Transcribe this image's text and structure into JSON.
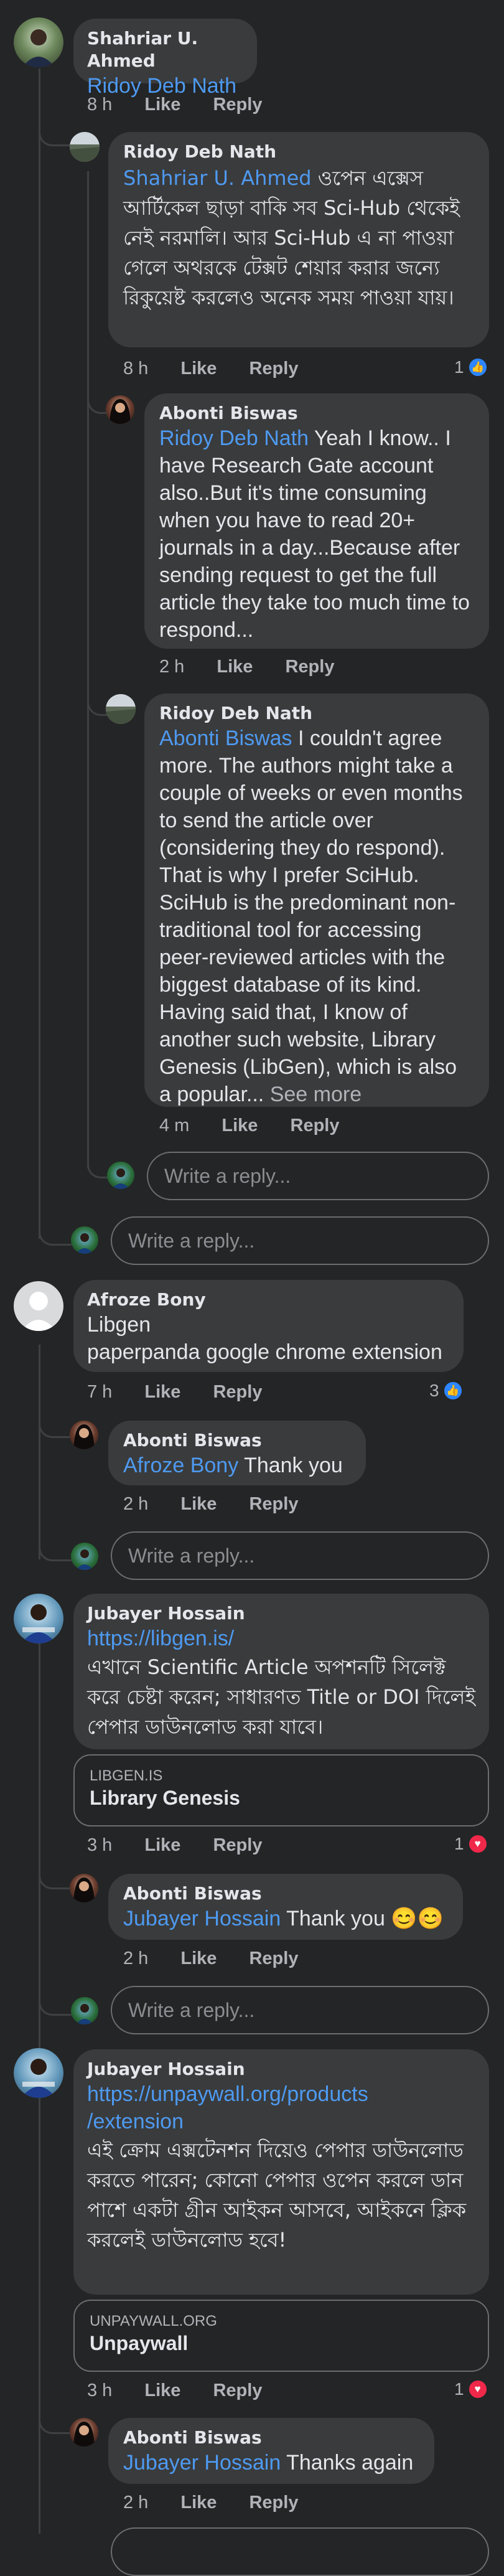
{
  "common": {
    "like_label": "Like",
    "reply_label": "Reply",
    "write_reply_placeholder": "Write a reply..."
  },
  "c1": {
    "author": "Shahriar U. Ahmed",
    "mention": "Ridoy Deb Nath",
    "time": "8 h"
  },
  "c1r1": {
    "author": "Ridoy Deb Nath",
    "mention": "Shahriar U. Ahmed",
    "text": "ওপেন এক্সেস আর্টিকেল ছাড়া বাকি সব Sci-Hub থেকেই নেই নরমালি। আর Sci-Hub এ না পাওয়া গেলে অথরকে টেক্সট শেয়ার করার জন্যে রিকুয়েষ্ট করলেও অনেক সময় পাওয়া যায়।",
    "time": "8 h",
    "reaction_count": "1"
  },
  "c1r2": {
    "author": "Abonti Biswas",
    "mention": "Ridoy Deb Nath",
    "text": "Yeah I know.. I have Research Gate account also..But it's time consuming when you have to read 20+ journals in a day...Because after sending request to get the full article they take too much time to respond...",
    "time": "2 h"
  },
  "c1r3": {
    "author": "Ridoy Deb Nath",
    "mention": "Abonti Biswas",
    "text": "I couldn't agree more. The authors might take a couple of weeks or even months to send the article over (considering they do respond). That is why I prefer SciHub. SciHub is the predominant non-traditional tool for accessing peer-reviewed articles with the biggest database of its kind. Having said that, I know of another such website, Library Genesis (LibGen), which is also a popular...",
    "see_more": "See more",
    "time": "4 m"
  },
  "c2": {
    "author": "Afroze Bony",
    "line1": "Libgen",
    "line2": "paperpanda google chrome extension",
    "time": "7 h",
    "reaction_count": "3"
  },
  "c2r1": {
    "author": "Abonti Biswas",
    "mention": "Afroze Bony",
    "text": "Thank you",
    "time": "2 h"
  },
  "c3": {
    "author": "Jubayer Hossain",
    "link": "https://libgen.is/",
    "text": "এখানে  Scientific Article অপশনটি সিলেক্ট করে চেষ্টা করেন; সাধারণত Title or DOI দিলেই পেপার ডাউনলোড করা যাবে।",
    "preview_domain": "LIBGEN.IS",
    "preview_title": "Library Genesis",
    "time": "3 h",
    "reaction_count": "1"
  },
  "c3r1": {
    "author": "Abonti Biswas",
    "mention": "Jubayer Hossain",
    "text": "Thank you 😊😊",
    "time": "2 h"
  },
  "c4": {
    "author": "Jubayer Hossain",
    "link_line1": "https://unpaywall.org/products",
    "link_line2": "/extension",
    "text": "এই ক্রোম এক্সটেনশন দিয়েও পেপার ডাউনলোড করতে পারেন; কোনো পেপার ওপেন করলে ডান পাশে একটা গ্রীন আইকন আসবে, আইকনে ক্লিক করলেই ডাউনলোড হবে!",
    "preview_domain": "UNPAYWALL.ORG",
    "preview_title": "Unpaywall",
    "time": "3 h",
    "reaction_count": "1"
  },
  "c4r1": {
    "author": "Abonti Biswas",
    "mention": "Jubayer Hossain",
    "text": "Thanks again",
    "time": "2 h"
  },
  "icons": {
    "like_reaction": "thumbs-up-icon",
    "love_reaction": "heart-icon"
  },
  "colors": {
    "background": "#242526",
    "bubble": "#3a3b3c",
    "mention": "#4e9af1",
    "like_blue": "#2d86ff",
    "love_red": "#f0284a"
  }
}
